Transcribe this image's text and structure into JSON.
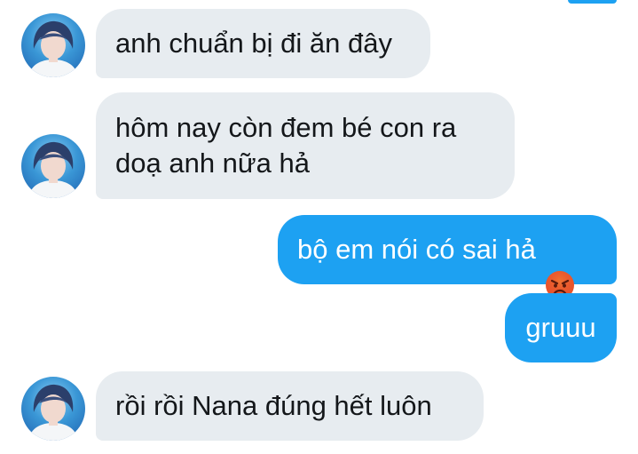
{
  "conversation": {
    "messages": [
      {
        "text": "anh chuẩn bị đi ăn đây",
        "direction": "incoming"
      },
      {
        "text": "hôm nay còn đem bé con ra\ndoạ anh nữa hả",
        "direction": "incoming"
      },
      {
        "text": "bộ em nói có sai hả",
        "direction": "outgoing",
        "emoji": "angry-face-icon"
      },
      {
        "text": "gruuu",
        "direction": "outgoing"
      },
      {
        "text": "rồi rồi Nana đúng hết luôn",
        "direction": "incoming"
      }
    ]
  },
  "colors": {
    "outgoing_bubble": "#1da1f2",
    "incoming_bubble": "#e7ecf0",
    "incoming_text": "#14171a",
    "outgoing_text": "#ffffff"
  }
}
